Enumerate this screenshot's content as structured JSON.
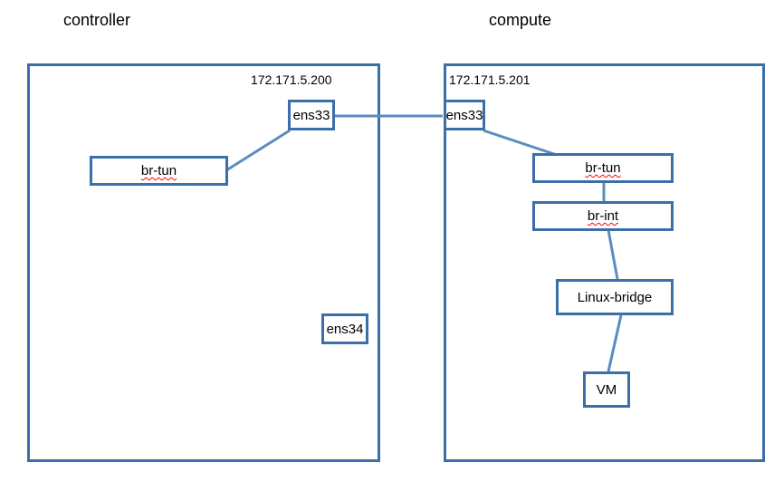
{
  "titles": {
    "controller": "controller",
    "compute": "compute"
  },
  "controller": {
    "ip": "172.171.5.200",
    "ens33": "ens33",
    "ens34": "ens34",
    "br_tun": "br-tun"
  },
  "compute": {
    "ip": "172.171.5.201",
    "ens33": "ens33",
    "br_tun": "br-tun",
    "br_int": "br-int",
    "linux_bridge": "Linux-bridge",
    "vm": "VM"
  }
}
